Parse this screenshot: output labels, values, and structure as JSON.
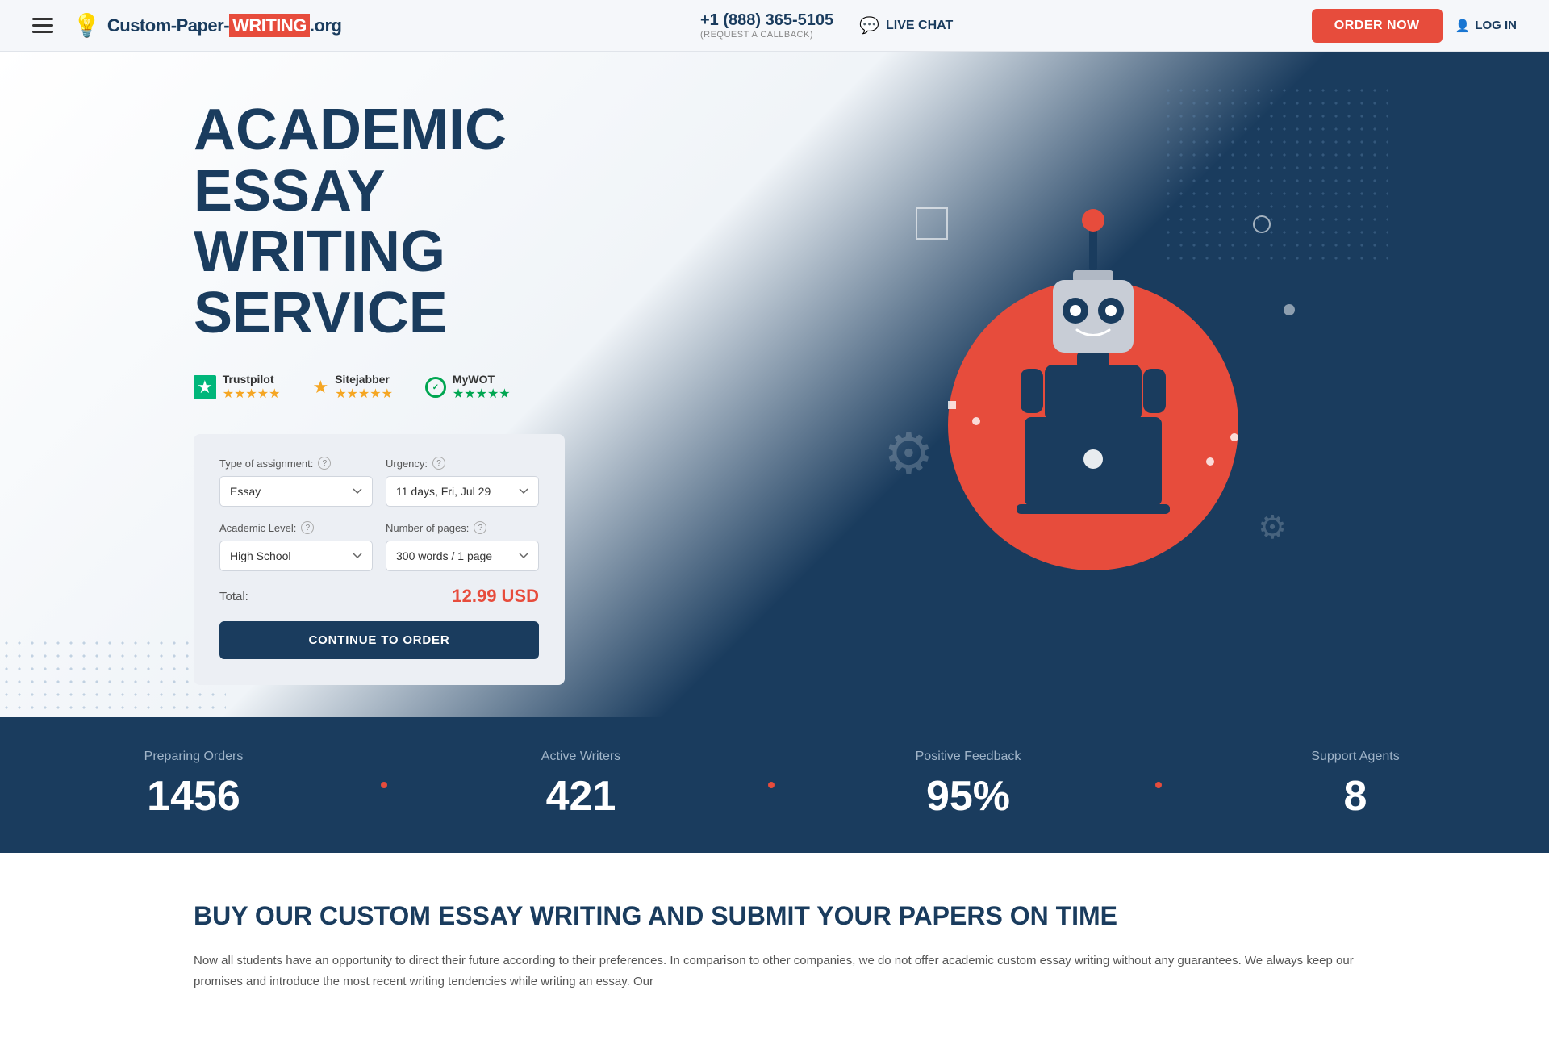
{
  "header": {
    "menu_icon_label": "☰",
    "logo_text_before": "Custom-Paper-",
    "logo_writing": "WRITING",
    "logo_org": ".org",
    "phone": "+1 (888) 365-5105",
    "callback_text": "(REQUEST A CALLBACK)",
    "live_chat": "LIVE CHAT",
    "order_now": "ORDER NOW",
    "login": "LOG IN"
  },
  "ratings": [
    {
      "name": "Trustpilot",
      "stars": "★★★★★",
      "type": "trustpilot"
    },
    {
      "name": "Sitejabber",
      "stars": "★★★★★",
      "type": "sitejabber"
    },
    {
      "name": "MyWOT",
      "stars": "★★★★★",
      "type": "mywot"
    }
  ],
  "hero": {
    "title_line1": "ACADEMIC ESSAY",
    "title_line2": "WRITING SERVICE"
  },
  "form": {
    "assignment_label": "Type of assignment:",
    "urgency_label": "Urgency:",
    "academic_label": "Academic Level:",
    "pages_label": "Number of pages:",
    "assignment_value": "Essay",
    "urgency_value": "11 days, Fri, Jul 29",
    "academic_value": "High School",
    "pages_value": "300 words / 1 page",
    "total_label": "Total:",
    "total_price": "12.99 USD",
    "continue_btn": "CONTINUE TO ORDER"
  },
  "stats": [
    {
      "label": "Preparing Orders",
      "value": "1456"
    },
    {
      "label": "Active Writers",
      "value": "421"
    },
    {
      "label": "Positive Feedback",
      "value": "95%"
    },
    {
      "label": "Support Agents",
      "value": "8"
    }
  ],
  "bottom": {
    "title": "BUY OUR CUSTOM ESSAY WRITING AND SUBMIT YOUR PAPERS ON TIME",
    "text": "Now all students have an opportunity to direct their future according to their preferences. In comparison to other companies, we do not offer academic custom essay writing without any guarantees. We always keep our promises and introduce the most recent writing tendencies while writing an essay. Our"
  },
  "colors": {
    "primary": "#1a3c5e",
    "accent": "#e74c3c",
    "bg_light": "#f5f7fa",
    "bg_form": "#eceff4"
  }
}
